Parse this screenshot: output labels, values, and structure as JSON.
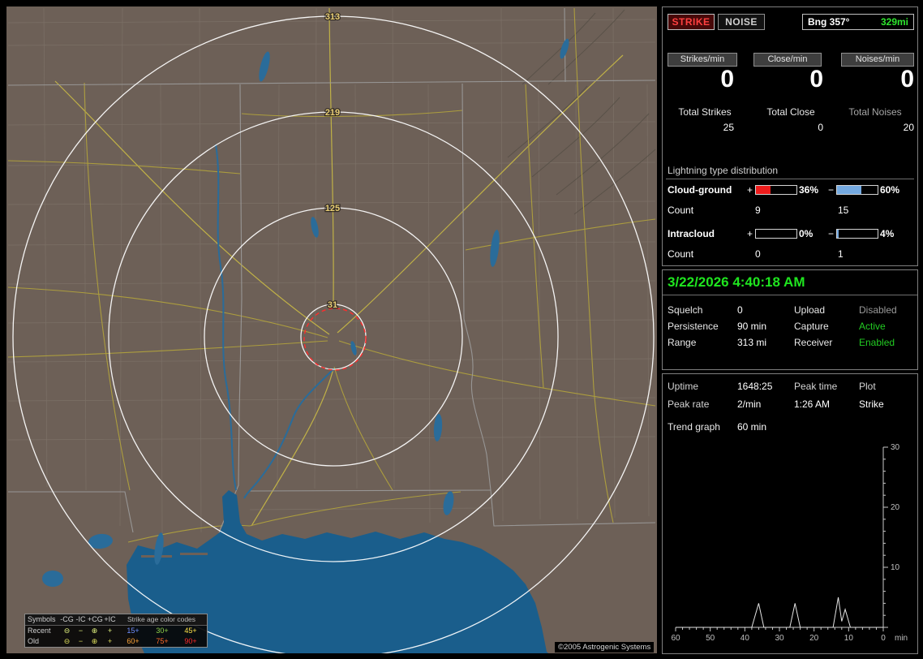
{
  "colors": {
    "accent_green": "#22cc22",
    "strike_red": "#ff4040",
    "bar_positive_red": "#ee1c1c",
    "bar_negative_blue": "#74a9e0",
    "ring_label_yellow": "#e8cd74",
    "water_blue": "#1a5e8c",
    "land_brown": "#6d6057",
    "age_colors": [
      "#6f8fff",
      "#8fd24a",
      "#ffe34a",
      "#ffa63a",
      "#ff6a2a",
      "#ff2a2a"
    ]
  },
  "map": {
    "rings": [
      {
        "label": "313"
      },
      {
        "label": "219"
      },
      {
        "label": "125"
      },
      {
        "label": "31"
      }
    ],
    "copyright": "©2005 Astrogenic Systems",
    "legend": {
      "symbols_header": "Symbols",
      "columns": [
        "-CG",
        "-IC",
        "+CG",
        "+IC"
      ],
      "age_header": "Strike age color codes",
      "rows": [
        {
          "label": "Recent",
          "symbols": [
            "⊖",
            "−",
            "⊕",
            "+"
          ],
          "ages": [
            "15+",
            "30+",
            "45+"
          ]
        },
        {
          "label": "Old",
          "symbols": [
            "⊖",
            "−",
            "⊕",
            "+"
          ],
          "ages": [
            "60+",
            "75+",
            "90+"
          ]
        }
      ]
    }
  },
  "header": {
    "strike_button": "STRIKE",
    "noise_button": "NOISE",
    "bearing": "Bng 357°",
    "range": "329mi"
  },
  "rates": {
    "buttons": [
      "Strikes/min",
      "Close/min",
      "Noises/min"
    ],
    "values": [
      "0",
      "0",
      "0"
    ],
    "totals": [
      {
        "label": "Total Strikes",
        "value": "25"
      },
      {
        "label": "Total Close",
        "value": "0"
      },
      {
        "label": "Total Noises",
        "value": "20"
      }
    ]
  },
  "distribution": {
    "title": "Lightning type distribution",
    "count_label": "Count",
    "plus_sign": "+",
    "minus_sign": "−",
    "rows": [
      {
        "label": "Cloud-ground",
        "plus_pct": "36%",
        "minus_pct": "60%",
        "plus_fill": 36,
        "minus_fill": 60,
        "plus_count": "9",
        "minus_count": "15"
      },
      {
        "label": "Intracloud",
        "plus_pct": "0%",
        "minus_pct": "4%",
        "plus_fill": 0,
        "minus_fill": 4,
        "plus_count": "0",
        "minus_count": "1"
      }
    ]
  },
  "status": {
    "datetime": "3/22/2026 4:40:18 AM",
    "rows": [
      [
        {
          "label": "Squelch",
          "value": "0",
          "state": ""
        },
        {
          "label": "Upload",
          "value": "Disabled",
          "state": "disabled"
        }
      ],
      [
        {
          "label": "Persistence",
          "value": "90 min",
          "state": ""
        },
        {
          "label": "Capture",
          "value": "Active",
          "state": "active"
        }
      ],
      [
        {
          "label": "Range",
          "value": "313 mi",
          "state": ""
        },
        {
          "label": "Receiver",
          "value": "Enabled",
          "state": "active"
        }
      ]
    ]
  },
  "stats": {
    "row1": {
      "c1": "Uptime",
      "c2": "1648:25",
      "c3": "Peak time",
      "c4": "Plot"
    },
    "row2": {
      "c1": "Peak rate",
      "c2": "2/min",
      "c3": "1:26 AM",
      "c4": "Strike"
    },
    "trend_label": "Trend graph",
    "trend_window": "60 min"
  },
  "chart_data": {
    "type": "line",
    "title": "Trend graph",
    "window_label": "60 min",
    "x_range": [
      60,
      0
    ],
    "y_range": [
      0,
      30
    ],
    "x_ticks": [
      60,
      50,
      40,
      30,
      20,
      10,
      0
    ],
    "y_ticks": [
      0,
      10,
      20,
      30
    ],
    "x_unit": "min",
    "grid": false,
    "legend_position": "none",
    "series": [
      {
        "name": "Strike",
        "points": [
          [
            60,
            0
          ],
          [
            38,
            0
          ],
          [
            36,
            4
          ],
          [
            34.5,
            0
          ],
          [
            27,
            0
          ],
          [
            25.5,
            4
          ],
          [
            24,
            0
          ],
          [
            14.5,
            0
          ],
          [
            13,
            5
          ],
          [
            12,
            1
          ],
          [
            11,
            3
          ],
          [
            9.5,
            0
          ],
          [
            0,
            0
          ]
        ]
      }
    ]
  }
}
